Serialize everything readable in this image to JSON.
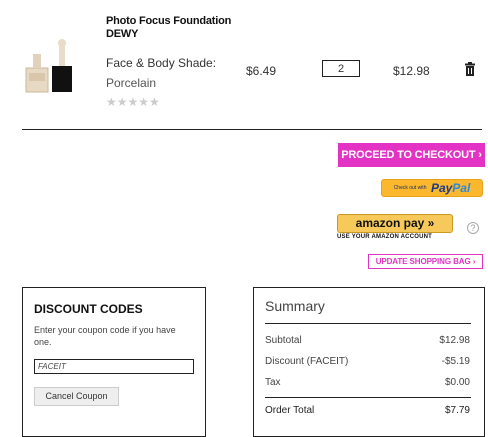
{
  "product": {
    "name": "Photo Focus Foundation DEWY",
    "shade_label": "Face & Body Shade:",
    "shade_value": "Porcelain",
    "stars": "★★★★★",
    "price": "$6.49",
    "quantity": "2",
    "subtotal": "$12.98"
  },
  "actions": {
    "checkout_label": "PROCEED TO CHECKOUT  ›",
    "paypal_small": "Check out with",
    "paypal_pay": "Pay",
    "paypal_pal": "Pal",
    "amazon_label": "amazon pay  »",
    "amazon_sub": "USE YOUR AMAZON ACCOUNT",
    "help": "?",
    "update_bag_label": "UPDATE SHOPPING BAG  ›"
  },
  "discount": {
    "title": "DISCOUNT CODES",
    "text": "Enter your coupon code if you have one.",
    "coupon_value": "FACEIT",
    "cancel_label": "Cancel Coupon"
  },
  "summary": {
    "title": "Summary",
    "rows": [
      {
        "label": "Subtotal",
        "value": "$12.98"
      },
      {
        "label": "Discount (FACEIT)",
        "value": "-$5.19"
      },
      {
        "label": "Tax",
        "value": "$0.00"
      }
    ],
    "total_label": "Order Total",
    "total_value": "$7.79"
  }
}
